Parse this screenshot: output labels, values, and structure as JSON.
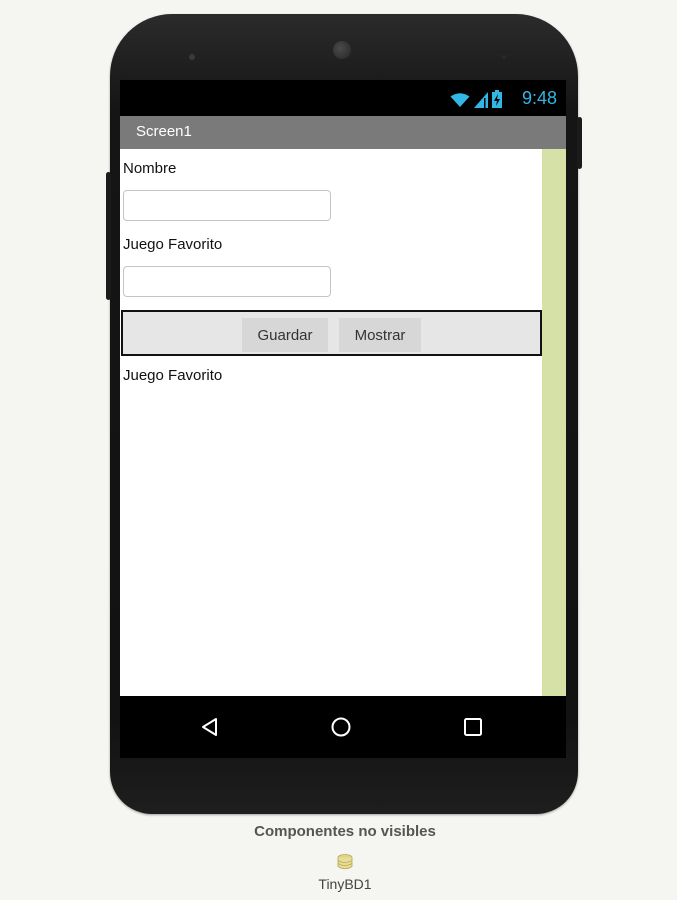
{
  "status_bar": {
    "time": "9:48",
    "wifi_icon": "wifi-icon",
    "signal_icon": "cell-signal-icon",
    "battery_icon": "battery-charging-icon",
    "accent_color": "#33b5e5"
  },
  "app_bar": {
    "title": "Screen1"
  },
  "form": {
    "name_label": "Nombre",
    "name_value": "",
    "game_label": "Juego Favorito",
    "game_value": "",
    "save_button": "Guardar",
    "show_button": "Mostrar",
    "result_label": "Juego Favorito"
  },
  "navigation": {
    "back_icon": "back-triangle-icon",
    "home_icon": "home-circle-icon",
    "recents_icon": "recents-square-icon"
  },
  "non_visible": {
    "title": "Componentes no visibles",
    "items": [
      {
        "icon": "database-icon",
        "label": "TinyBD1"
      }
    ]
  },
  "colors": {
    "screen_scroll": "#d5e1a6",
    "title_bar": "#7a7a7a"
  }
}
